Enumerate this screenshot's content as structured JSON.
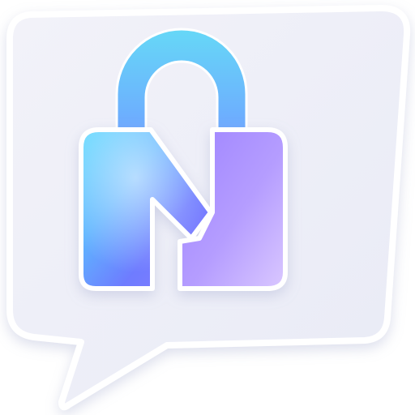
{
  "icon": {
    "name": "lock-chat-app-icon",
    "bubble_color": "#eff0f8",
    "bubble_border_color": "#ffffff",
    "shackle_colors": [
      "#5fd6f6",
      "#6aa6ff"
    ],
    "body_colors": [
      "#5ed9ff",
      "#5fb7ff",
      "#6f7bff",
      "#a28cff",
      "#d7c8ff"
    ]
  }
}
